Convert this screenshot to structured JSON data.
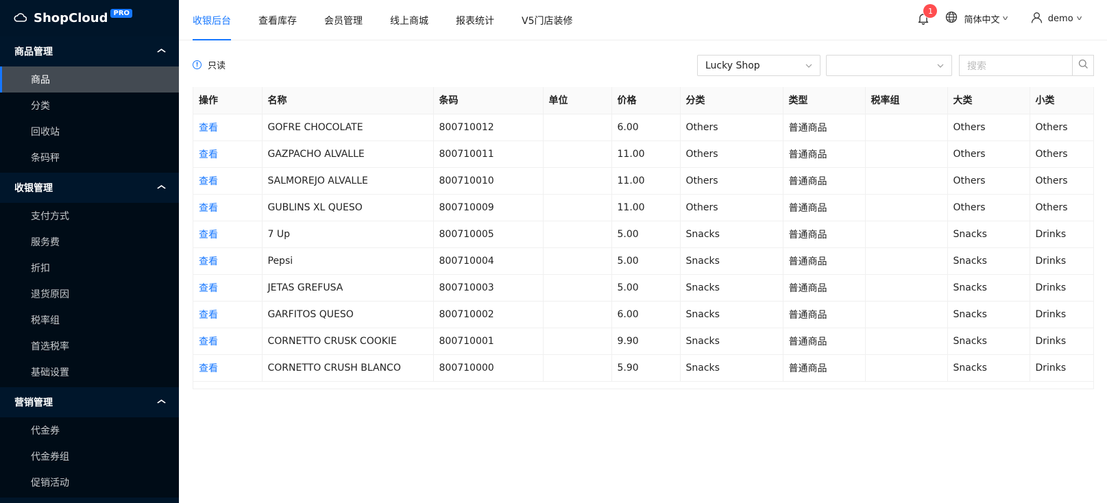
{
  "app": {
    "brand": "ShopCloud",
    "badge": "PRO"
  },
  "sidebar": {
    "groups": [
      {
        "title": "商品管理",
        "items": [
          "商品",
          "分类",
          "回收站",
          "条码秤"
        ],
        "active": 0
      },
      {
        "title": "收银管理",
        "items": [
          "支付方式",
          "服务费",
          "折扣",
          "退货原因",
          "税率组",
          "首选税率",
          "基础设置"
        ]
      },
      {
        "title": "营销管理",
        "items": [
          "代金券",
          "代金券组",
          "促销活动"
        ]
      }
    ]
  },
  "header": {
    "tabs": [
      "收银后台",
      "查看库存",
      "会员管理",
      "线上商城",
      "报表统计",
      "V5门店装修"
    ],
    "active_tab": 0,
    "notifications": "1",
    "language": "简体中文",
    "user": "demo"
  },
  "toolbar": {
    "readonly_label": "只读",
    "shop_select": "Lucky Shop",
    "second_select": "",
    "search_placeholder": "搜索"
  },
  "table": {
    "columns": [
      "操作",
      "名称",
      "条码",
      "单位",
      "价格",
      "分类",
      "类型",
      "税率组",
      "大类",
      "小类"
    ],
    "rows": [
      [
        "查看",
        "GOFRE CHOCOLATE",
        "800710012",
        "",
        "6.00",
        "Others",
        "普通商品",
        "",
        "Others",
        "Others"
      ],
      [
        "查看",
        "GAZPACHO ALVALLE",
        "800710011",
        "",
        "11.00",
        "Others",
        "普通商品",
        "",
        "Others",
        "Others"
      ],
      [
        "查看",
        "SALMOREJO ALVALLE",
        "800710010",
        "",
        "11.00",
        "Others",
        "普通商品",
        "",
        "Others",
        "Others"
      ],
      [
        "查看",
        "GUBLINS XL QUESO",
        "800710009",
        "",
        "11.00",
        "Others",
        "普通商品",
        "",
        "Others",
        "Others"
      ],
      [
        "查看",
        "7 Up",
        "800710005",
        "",
        "5.00",
        "Snacks",
        "普通商品",
        "",
        "Snacks",
        "Drinks"
      ],
      [
        "查看",
        "Pepsi",
        "800710004",
        "",
        "5.00",
        "Snacks",
        "普通商品",
        "",
        "Snacks",
        "Drinks"
      ],
      [
        "查看",
        "JETAS GREFUSA",
        "800710003",
        "",
        "5.00",
        "Snacks",
        "普通商品",
        "",
        "Snacks",
        "Drinks"
      ],
      [
        "查看",
        "GARFITOS QUESO",
        "800710002",
        "",
        "6.00",
        "Snacks",
        "普通商品",
        "",
        "Snacks",
        "Drinks"
      ],
      [
        "查看",
        "CORNETTO CRUSK COOKIE",
        "800710001",
        "",
        "9.90",
        "Snacks",
        "普通商品",
        "",
        "Snacks",
        "Drinks"
      ],
      [
        "查看",
        "CORNETTO CRUSH BLANCO",
        "800710000",
        "",
        "5.90",
        "Snacks",
        "普通商品",
        "",
        "Snacks",
        "Drinks"
      ]
    ]
  },
  "colors": {
    "sidebar_bg": "#001529",
    "accent": "#1677ff",
    "badge": "#ff4d4f"
  }
}
